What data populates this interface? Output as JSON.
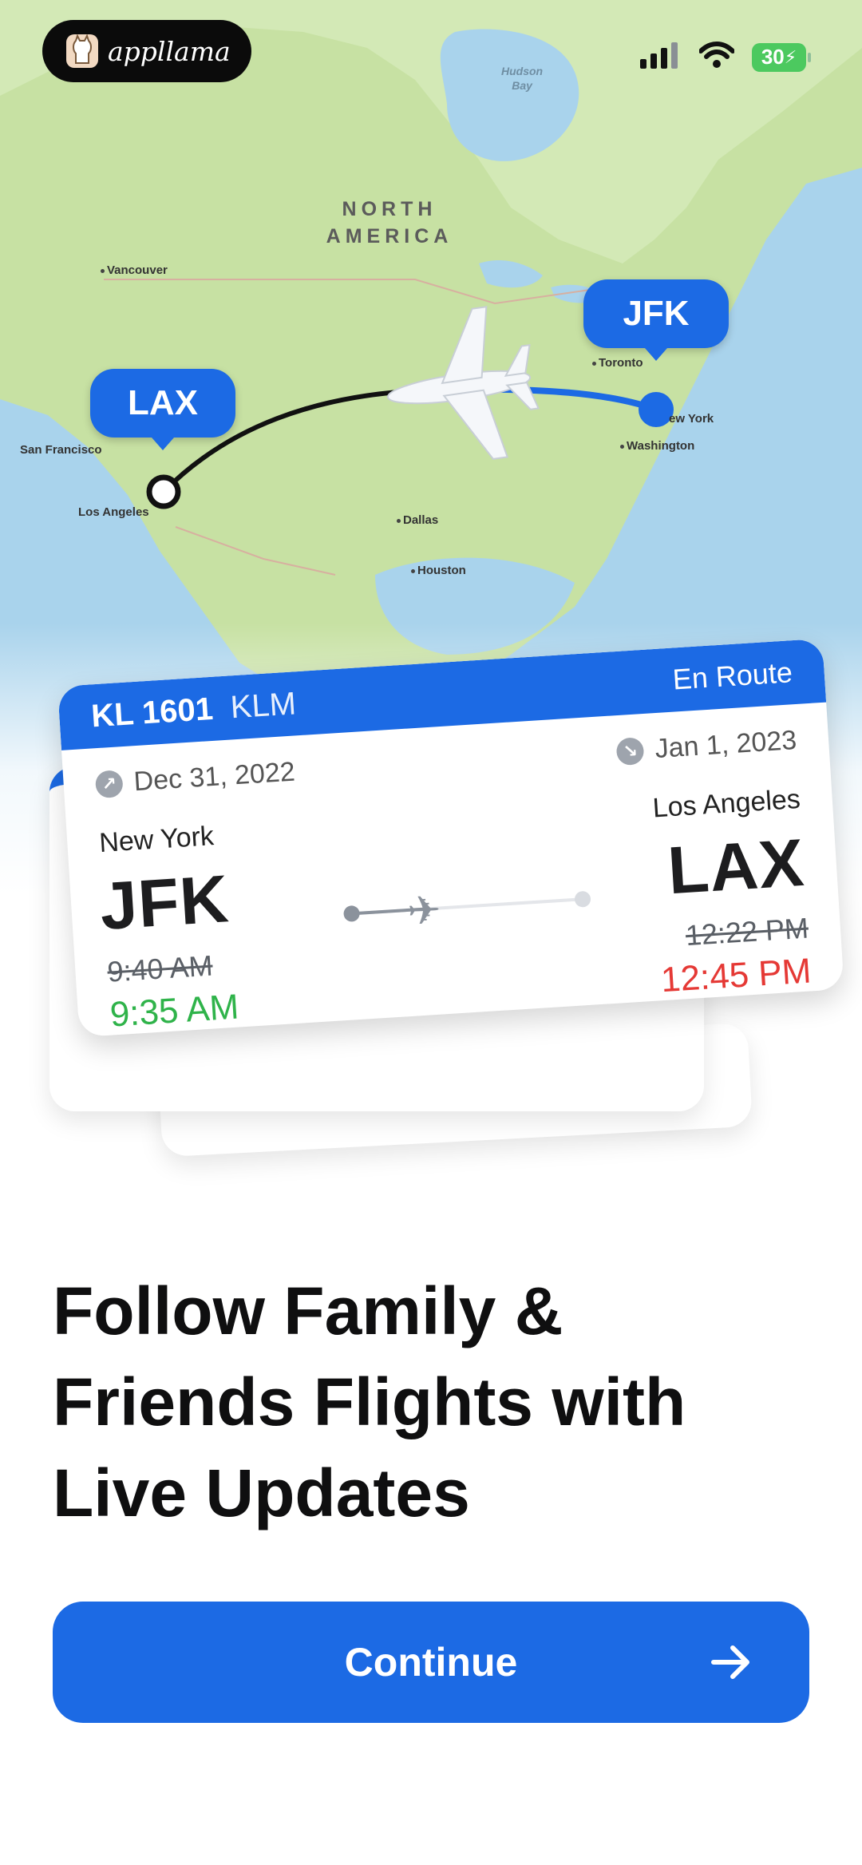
{
  "brand": {
    "name": "appllama"
  },
  "status_bar": {
    "battery": "30"
  },
  "map": {
    "region_label": "NORTH\nAMERICA",
    "water_label": "Hudson\nBay",
    "cities": [
      "Vancouver",
      "San Francisco",
      "Los Angeles",
      "Dallas",
      "Houston",
      "Toronto",
      "ew York",
      "Washington"
    ],
    "origin_pin": "LAX",
    "destination_pin": "JFK"
  },
  "card": {
    "flight_number": "KL 1601",
    "airline": "KLM",
    "status": "En Route",
    "departure": {
      "date": "Dec 31, 2022",
      "city": "New York",
      "code": "JFK",
      "scheduled_time": "9:40 AM",
      "actual_time": "9:35 AM"
    },
    "arrival": {
      "date": "Jan 1, 2023",
      "city": "Los Angeles",
      "code": "LAX",
      "scheduled_time": "12:22 PM",
      "actual_time": "12:45 PM"
    }
  },
  "headline": "Follow Family & Friends Flights with Live Updates",
  "cta": {
    "label": "Continue"
  },
  "colors": {
    "accent": "#1c6ae4",
    "on_time": "#2fb34a",
    "delayed": "#e53935",
    "land": "#c9e2a8",
    "water": "#a9d3ec"
  }
}
